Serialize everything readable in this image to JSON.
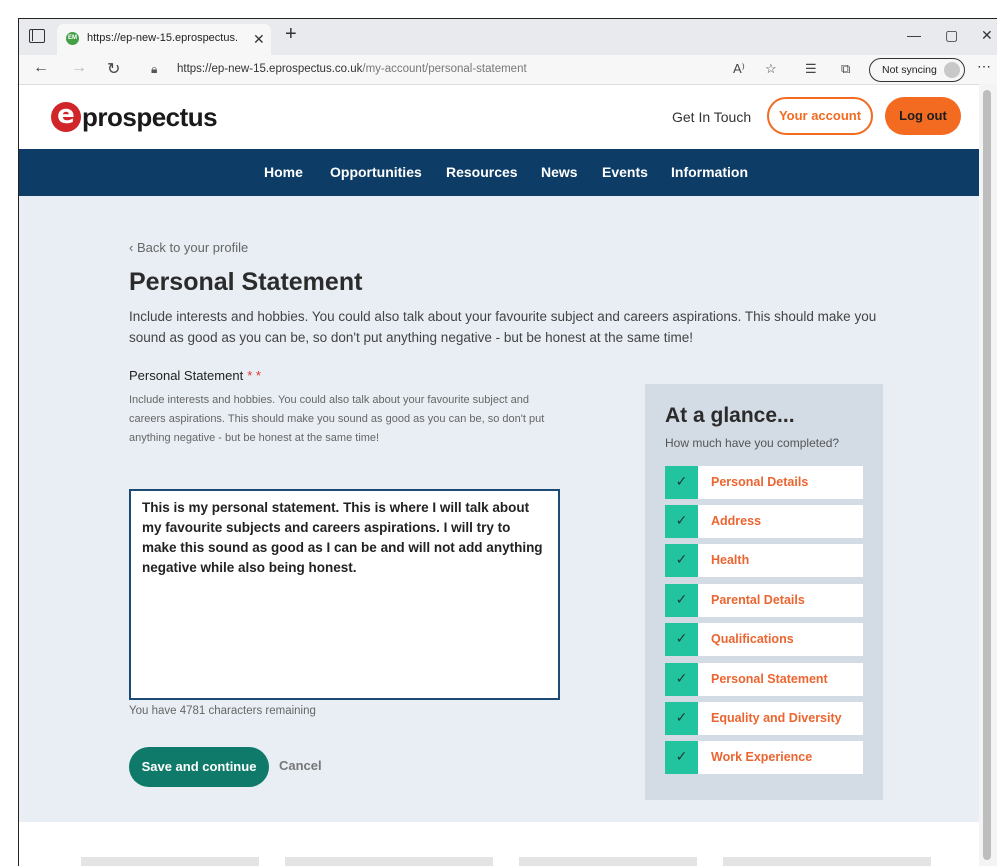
{
  "browser": {
    "tab_title": "https://ep-new-15.eprospectus.c",
    "favicon_text": "EM",
    "url_host": "https://ep-new-15.eprospectus.co.uk",
    "url_path": "/my-account/personal-statement",
    "sync_label": "Not syncing"
  },
  "header": {
    "logo_mark": "e",
    "logo_text": "prospectus",
    "get_in_touch": "Get In Touch",
    "account_label": "Your account",
    "logout_label": "Log out"
  },
  "nav": {
    "items": [
      "Home",
      "Opportunities",
      "Resources",
      "News",
      "Events",
      "Information"
    ]
  },
  "main": {
    "back_link": "‹ Back to your profile",
    "title": "Personal Statement",
    "intro": "Include interests and hobbies. You could also talk about your favourite subject and careers aspirations. This should make you sound as good as you can be, so don't put anything negative - but be honest at the same time!",
    "field_label": "Personal Statement",
    "required_mark": "* *",
    "help_text": "Include interests and hobbies. You could also talk about your favourite subject and careers aspirations. This should make you sound as good as you can be, so don't put anything negative - but be honest at the same time!",
    "statement_value": "This is my personal statement. This is where I will talk about my favourite subjects and careers aspirations. I will try to make this sound as good as I can be and will not add anything negative while also being honest.",
    "counter": "You have 4781 characters remaining",
    "save_label": "Save and continue",
    "cancel_label": "Cancel"
  },
  "glance": {
    "title": "At a glance...",
    "subtitle": "How much have you completed?",
    "items": [
      {
        "label": "Personal Details",
        "done": true
      },
      {
        "label": "Address",
        "done": true
      },
      {
        "label": "Health",
        "done": true
      },
      {
        "label": "Parental Details",
        "done": true
      },
      {
        "label": "Qualifications",
        "done": true
      },
      {
        "label": "Personal Statement",
        "done": true
      },
      {
        "label": "Equality and Diversity",
        "done": true
      },
      {
        "label": "Work Experience",
        "done": true
      }
    ]
  },
  "colors": {
    "brand_orange": "#f26b21",
    "nav_blue": "#0d3d66",
    "save_green": "#0f7a6a",
    "check_teal": "#22c4a0"
  }
}
